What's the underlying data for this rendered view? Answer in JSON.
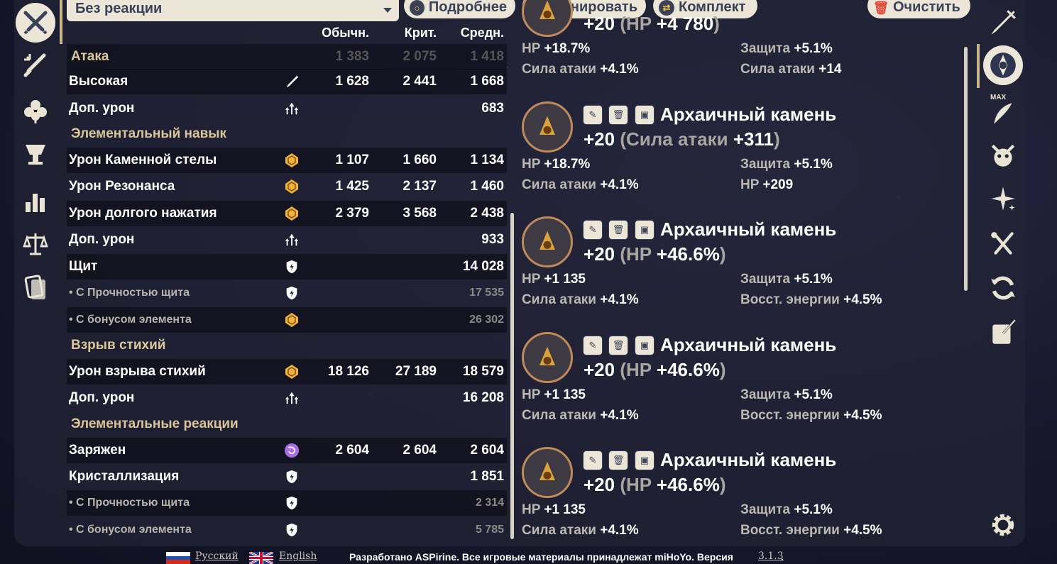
{
  "toolbar": {
    "reaction_select": "Без реакции",
    "details_label": "Подробнее",
    "scan_label": "Сканировать",
    "set_label": "Комплект",
    "clear_label": "Очистить"
  },
  "table": {
    "headers": [
      "Обычн.",
      "Крит.",
      "Средн."
    ],
    "sections": {
      "attack": "Атака",
      "skill": "Элементальный навык",
      "burst": "Взрыв стихий",
      "reactions": "Элементальные реакции"
    },
    "rows": [
      {
        "label": "Высокая",
        "icon": "plunge-icon",
        "v": [
          "1 628",
          "2 441",
          "1 668"
        ]
      },
      {
        "label": "Доп. урон",
        "icon": "bonus-damage-icon",
        "v": [
          "",
          "",
          "683"
        ]
      },
      {
        "label": "Урон Каменной стелы",
        "icon": "geo-icon",
        "v": [
          "1 107",
          "1 660",
          "1 134"
        ]
      },
      {
        "label": "Урон Резонанса",
        "icon": "geo-icon",
        "v": [
          "1 425",
          "2 137",
          "1 460"
        ]
      },
      {
        "label": "Урон долгого нажатия",
        "icon": "geo-icon",
        "v": [
          "2 379",
          "3 568",
          "2 438"
        ]
      },
      {
        "label": "Доп. урон",
        "icon": "bonus-damage-icon",
        "v": [
          "",
          "",
          "933"
        ]
      },
      {
        "label": "Щит",
        "icon": "shield-icon",
        "v": [
          "",
          "",
          "14 028"
        ]
      },
      {
        "label": "• С Прочностью щита",
        "icon": "shield-icon",
        "v": [
          "",
          "",
          "17 535"
        ]
      },
      {
        "label": "• С бонусом элемента",
        "icon": "geo-icon",
        "v": [
          "",
          "",
          "26 302"
        ]
      },
      {
        "label": "Урон взрыва стихий",
        "icon": "geo-icon",
        "v": [
          "18 126",
          "27 189",
          "18 579"
        ]
      },
      {
        "label": "Доп. урон",
        "icon": "bonus-damage-icon",
        "v": [
          "",
          "",
          "16 208"
        ]
      },
      {
        "label": "Заряжен",
        "icon": "electro-icon",
        "v": [
          "2 604",
          "2 604",
          "2 604"
        ]
      },
      {
        "label": "Кристаллизация",
        "icon": "shield-icon",
        "v": [
          "",
          "",
          "1 851"
        ]
      },
      {
        "label": "• С Прочностью щита",
        "icon": "shield-icon",
        "v": [
          "",
          "",
          "2 314"
        ]
      },
      {
        "label": "• С бонусом элемента",
        "icon": "shield-icon",
        "v": [
          "",
          "",
          "5 785"
        ]
      }
    ],
    "faded_attack_values": [
      "1 383",
      "2 075",
      "1 418"
    ]
  },
  "artifacts": [
    {
      "name": "",
      "main": "+20 (HP +4 780)",
      "level": "+20",
      "main_stat": "HP",
      "main_value": "+4 780",
      "subs": [
        [
          "HP",
          "+18.7%"
        ],
        [
          "Защита",
          "+5.1%"
        ],
        [
          "Сила атаки",
          "+4.1%"
        ],
        [
          "Сила атаки",
          "+14"
        ]
      ]
    },
    {
      "name": "Архаичный камень",
      "level": "+20",
      "main_stat": "Сила атаки",
      "main_value": "+311",
      "subs": [
        [
          "HP",
          "+18.7%"
        ],
        [
          "Защита",
          "+5.1%"
        ],
        [
          "Сила атаки",
          "+4.1%"
        ],
        [
          "HP",
          "+209"
        ]
      ]
    },
    {
      "name": "Архаичный камень",
      "level": "+20",
      "main_stat": "HP",
      "main_value": "+46.6%",
      "subs": [
        [
          "HP",
          "+1 135"
        ],
        [
          "Защита",
          "+5.1%"
        ],
        [
          "Сила атаки",
          "+4.1%"
        ],
        [
          "Восст. энергии",
          "+4.5%"
        ]
      ]
    },
    {
      "name": "Архаичный камень",
      "level": "+20",
      "main_stat": "HP",
      "main_value": "+46.6%",
      "subs": [
        [
          "HP",
          "+1 135"
        ],
        [
          "Защита",
          "+5.1%"
        ],
        [
          "Сила атаки",
          "+4.1%"
        ],
        [
          "Восст. энергии",
          "+4.5%"
        ]
      ]
    },
    {
      "name": "Архаичный камень",
      "level": "+20",
      "main_stat": "HP",
      "main_value": "+46.6%",
      "subs": [
        [
          "HP",
          "+1 135"
        ],
        [
          "Защита",
          "+5.1%"
        ],
        [
          "Сила атаки",
          "+4.1%"
        ],
        [
          "Восст. энергии",
          "+4.5%"
        ]
      ]
    }
  ],
  "right_nav": {
    "max_tag": "MAX"
  },
  "footer": {
    "lang_ru": "Русский",
    "lang_en": "English",
    "credits": "Разработано ASPirine. Все игровые материалы принадлежат miHoYo. Версия ",
    "version": "3.1.3",
    "period": "."
  },
  "colors": {
    "accent": "#ece6d8",
    "gold": "#d9c69a",
    "panel": "#222436",
    "dark_text": "#3b4157"
  }
}
